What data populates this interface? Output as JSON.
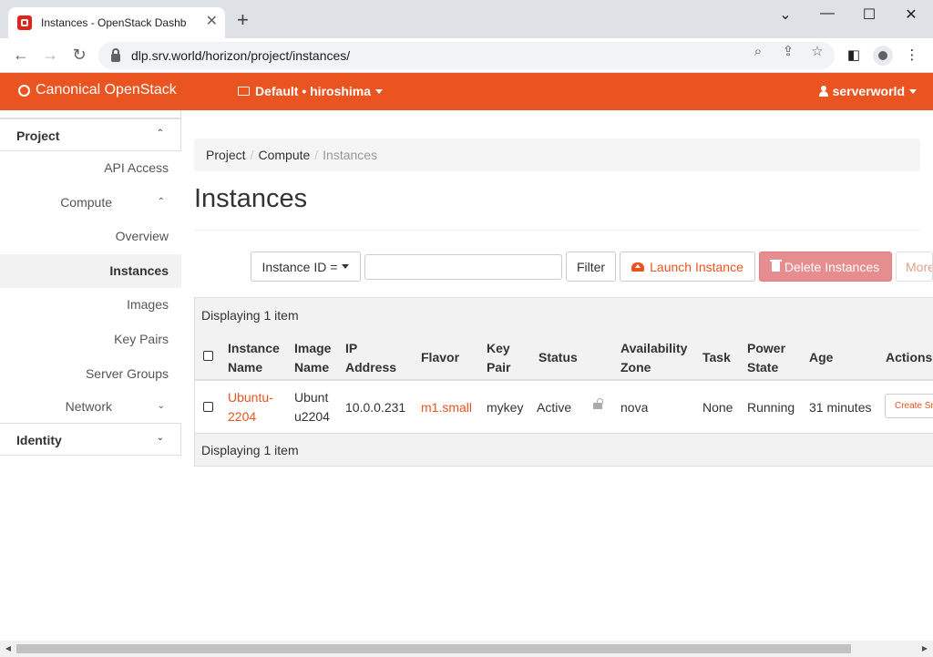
{
  "browser": {
    "tab_title": "Instances - OpenStack Dashboard",
    "url": "dlp.srv.world/horizon/project/instances/"
  },
  "topbar": {
    "brand": "Canonical OpenStack",
    "project_selector": "Default • hiroshima",
    "user": "serverworld"
  },
  "sidebar": {
    "project": "Project",
    "items": {
      "api_access": "API Access",
      "compute": "Compute",
      "overview": "Overview",
      "instances": "Instances",
      "images": "Images",
      "key_pairs": "Key Pairs",
      "server_groups": "Server Groups",
      "network": "Network"
    },
    "identity": "Identity"
  },
  "breadcrumb": {
    "project": "Project",
    "compute": "Compute",
    "current": "Instances"
  },
  "page": {
    "title": "Instances"
  },
  "actions": {
    "filter_select": "Instance ID =",
    "filter_value": "",
    "filter_button": "Filter",
    "launch": "Launch Instance",
    "delete": "Delete Instances",
    "more": "More"
  },
  "table": {
    "caption": "Displaying 1 item",
    "footer": "Displaying 1 item",
    "headers": {
      "name": [
        "Instance",
        "Name"
      ],
      "image": [
        "Image",
        "Name"
      ],
      "ip": [
        "IP",
        "Address"
      ],
      "flavor": "Flavor",
      "keypair": [
        "Key",
        "Pair"
      ],
      "status": "Status",
      "zone": [
        "Availability",
        "Zone"
      ],
      "task": "Task",
      "power": [
        "Power",
        "State"
      ],
      "age": "Age",
      "actions": "Actions"
    },
    "rows": [
      {
        "name": [
          "Ubuntu-",
          "2204"
        ],
        "image": [
          "Ubunt",
          "u2204"
        ],
        "ip": "10.0.0.231",
        "flavor": "m1.small",
        "keypair": "mykey",
        "status": "Active",
        "zone": "nova",
        "task": "None",
        "power": "Running",
        "age": "31 minutes",
        "action_button": "Create Snapshot"
      }
    ]
  },
  "colors": {
    "accent": "#e95420",
    "danger": "#e68d8f"
  }
}
